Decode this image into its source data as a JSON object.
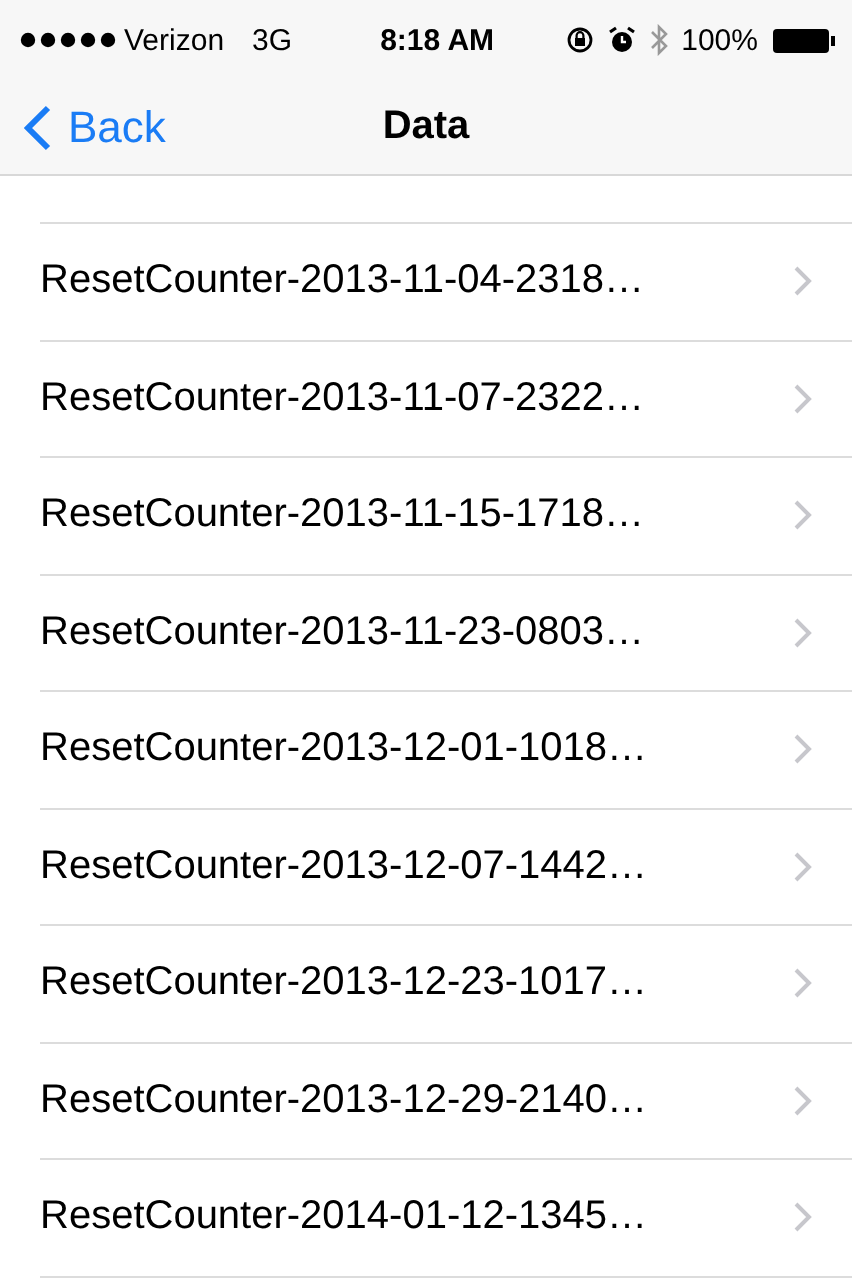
{
  "status_bar": {
    "carrier": "Verizon",
    "network": "3G",
    "time": "8:18 AM",
    "battery": "100%"
  },
  "nav": {
    "back": "Back",
    "title": "Data"
  },
  "rows": [
    {
      "label": "ResetCounter-2013-11-04-2318…"
    },
    {
      "label": "ResetCounter-2013-11-07-2322…"
    },
    {
      "label": "ResetCounter-2013-11-15-1718…"
    },
    {
      "label": "ResetCounter-2013-11-23-0803…"
    },
    {
      "label": "ResetCounter-2013-12-01-1018…"
    },
    {
      "label": "ResetCounter-2013-12-07-1442…"
    },
    {
      "label": "ResetCounter-2013-12-23-1017…"
    },
    {
      "label": "ResetCounter-2013-12-29-2140…"
    },
    {
      "label": "ResetCounter-2014-01-12-1345…"
    }
  ]
}
